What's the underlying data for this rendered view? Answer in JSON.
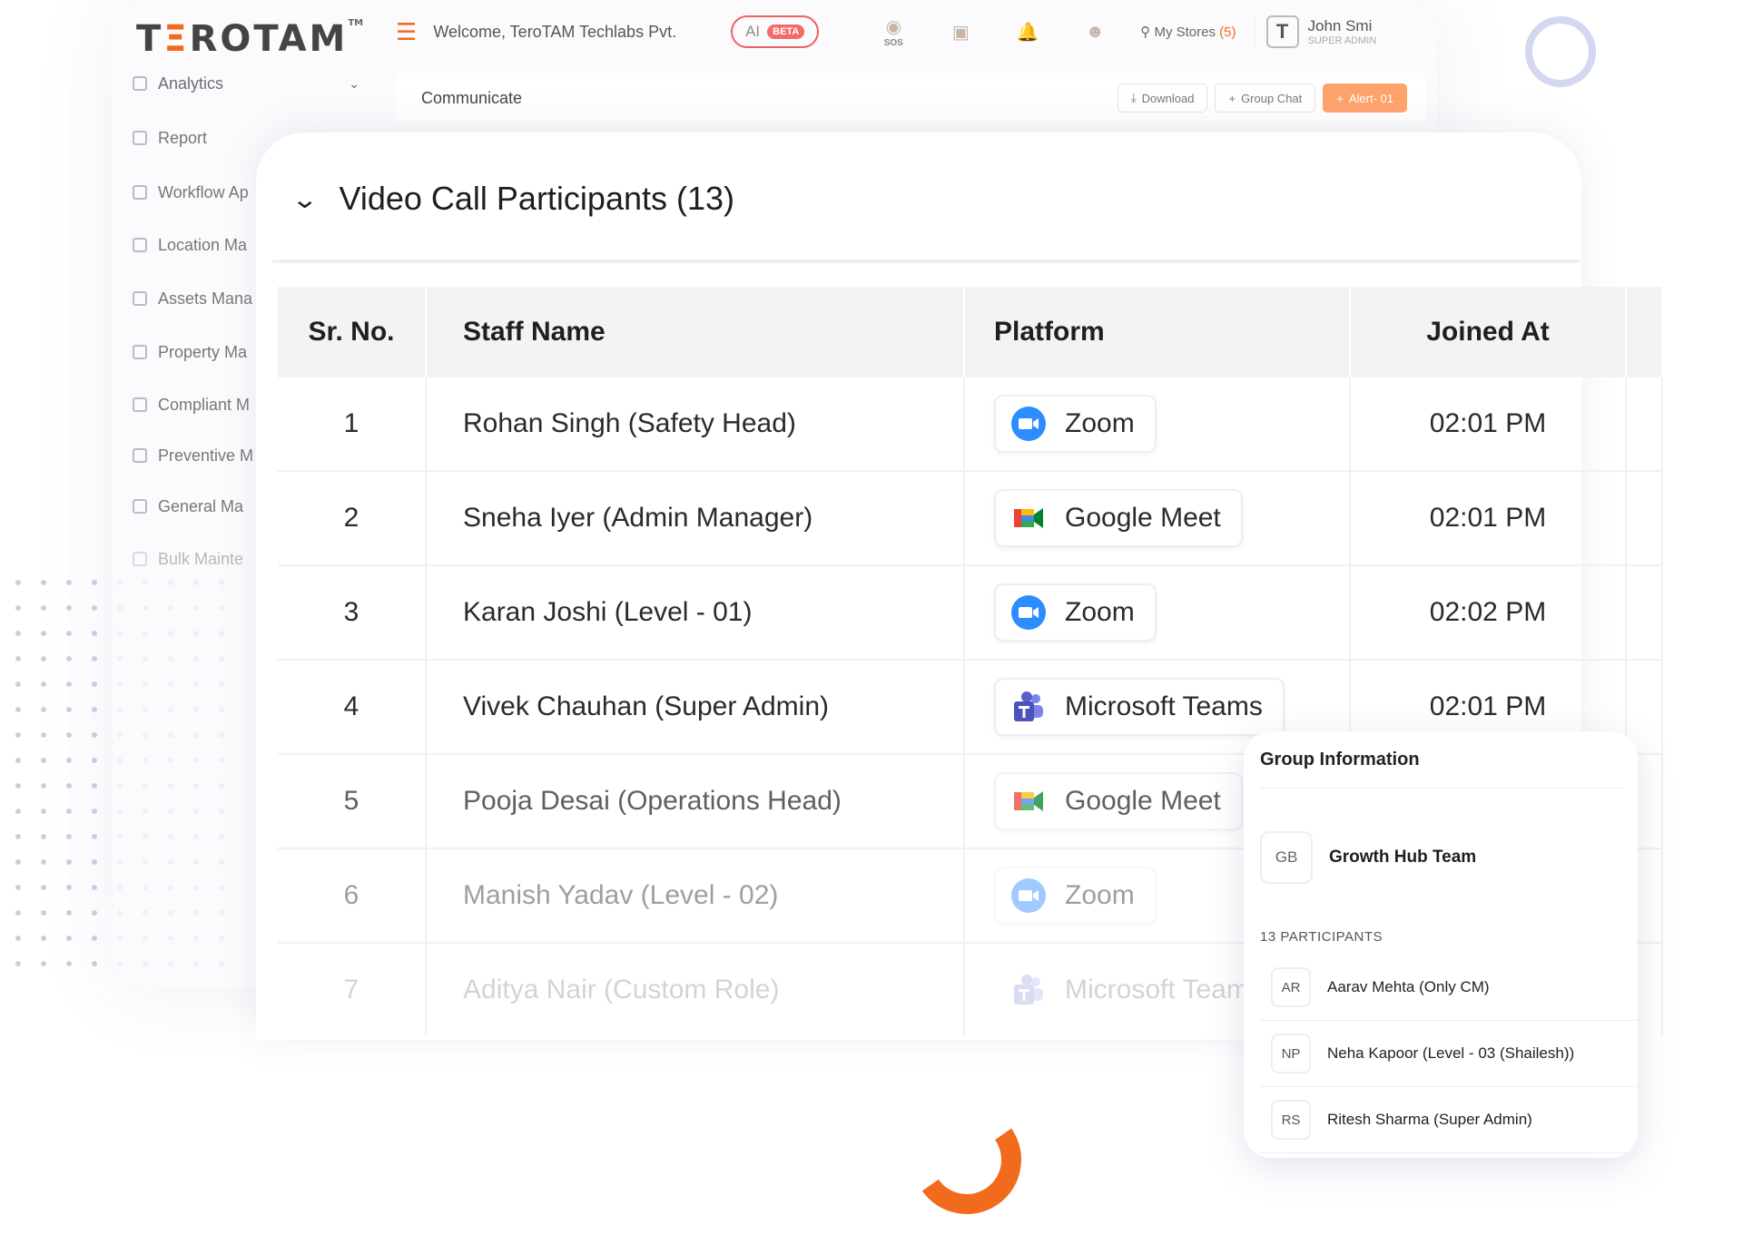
{
  "brand": {
    "logo_part1": "T",
    "logo_accent": "Ξ",
    "logo_part2": "ROTAM",
    "tm": "TM"
  },
  "sidebar": {
    "items": [
      {
        "label": "Analytics",
        "icon": "chart-icon"
      },
      {
        "label": "Report",
        "icon": "report-icon"
      },
      {
        "label": "Workflow Ap",
        "icon": "workflow-icon"
      },
      {
        "label": "Location Ma",
        "icon": "location-pin-icon"
      },
      {
        "label": "Assets Mana",
        "icon": "assets-icon"
      },
      {
        "label": "Property Ma",
        "icon": "property-icon"
      },
      {
        "label": "Compliant M",
        "icon": "compliance-icon"
      },
      {
        "label": "Preventive M",
        "icon": "preventive-icon"
      },
      {
        "label": "General Ma",
        "icon": "general-icon"
      },
      {
        "label": "Bulk Mainte",
        "icon": "bulk-icon"
      }
    ]
  },
  "header": {
    "welcome": "Welcome, TeroTAM Techlabs Pvt.",
    "ai_label": "AI",
    "beta_label": "BETA",
    "sos_label": "SOS",
    "stores_label": "My Stores",
    "stores_count": "(5)",
    "user_initial": "T",
    "user_name": "John Smi",
    "user_role": "SUPER ADMIN"
  },
  "communicate": {
    "title": "Communicate",
    "download_label": "Download",
    "group_chat_label": "Group Chat",
    "alert_label": "Alert- 01"
  },
  "participants": {
    "title": "Video Call Participants (13)",
    "columns": [
      "Sr. No.",
      "Staff Name",
      "Platform",
      "Joined At"
    ],
    "rows": [
      {
        "sr": "1",
        "name": "Rohan Singh (Safety Head)",
        "platform": "Zoom",
        "joined": "02:01 PM"
      },
      {
        "sr": "2",
        "name": "Sneha Iyer (Admin Manager)",
        "platform": "Google Meet",
        "joined": "02:01 PM"
      },
      {
        "sr": "3",
        "name": "Karan Joshi (Level - 01)",
        "platform": "Zoom",
        "joined": "02:02 PM"
      },
      {
        "sr": "4",
        "name": "Vivek Chauhan (Super Admin)",
        "platform": "Microsoft Teams",
        "joined": "02:01 PM"
      },
      {
        "sr": "5",
        "name": "Pooja Desai (Operations Head)",
        "platform": "Google Meet",
        "joined": ""
      },
      {
        "sr": "6",
        "name": "Manish Yadav (Level - 02)",
        "platform": "Zoom",
        "joined": ""
      },
      {
        "sr": "7",
        "name": "Aditya Nair (Custom Role)",
        "platform": "Microsoft Teams",
        "joined": ""
      }
    ]
  },
  "group_info": {
    "title": "Group Information",
    "team_initials": "GB",
    "team_name": "Growth Hub Team",
    "participants_count": "13 PARTICIPANTS",
    "members": [
      {
        "initials": "AR",
        "name": "Aarav Mehta (Only CM)"
      },
      {
        "initials": "NP",
        "name": "Neha Kapoor (Level - 03 (Shailesh))"
      },
      {
        "initials": "RS",
        "name": "Ritesh Sharma (Super Admin)"
      }
    ]
  },
  "colors": {
    "accent": "#f26a1b",
    "zoom": "#2d8cff",
    "teams": "#5b5fc7"
  }
}
